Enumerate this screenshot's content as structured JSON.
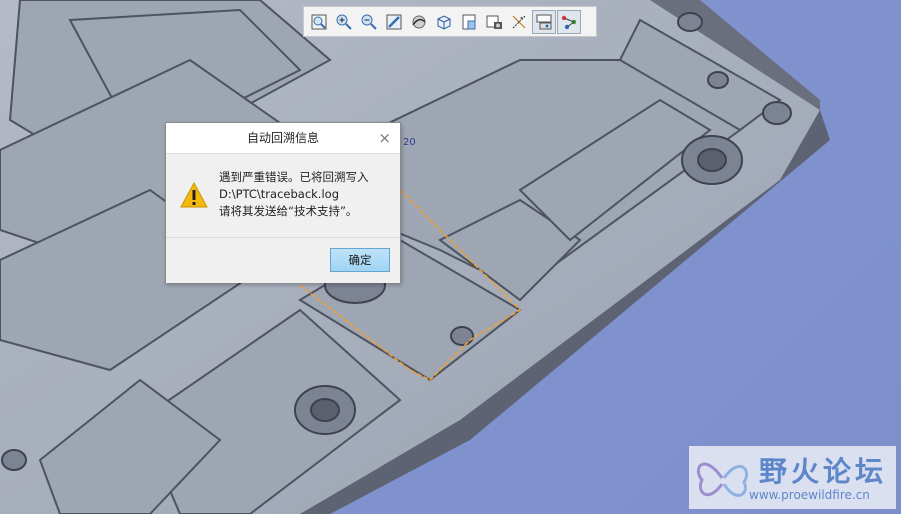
{
  "toolbar": {
    "buttons": [
      {
        "icon": "zoom-fit-icon"
      },
      {
        "icon": "zoom-in-icon"
      },
      {
        "icon": "zoom-out-icon"
      },
      {
        "icon": "repaint-icon"
      },
      {
        "icon": "reorient-icon"
      },
      {
        "icon": "display-style-icon"
      },
      {
        "icon": "saved-views-icon"
      },
      {
        "icon": "view-manager-icon"
      },
      {
        "icon": "datum-display-icon"
      },
      {
        "icon": "spin-center-icon",
        "active": true
      },
      {
        "icon": "annotation-display-icon",
        "active": true
      }
    ]
  },
  "dialog": {
    "title": "自动回溯信息",
    "close": "×",
    "icon": "warning-icon",
    "message_line1": "遇到严重错误。已将回溯写入",
    "message_line2": "D:\\PTC\\traceback.log",
    "message_line3": "请将其发送给“技术支持”。",
    "ok_label": "确定"
  },
  "viewport": {
    "label": "20"
  },
  "watermark": {
    "title": "野火论坛",
    "url": "www.proewildfire.cn"
  },
  "colors": {
    "background": "#8294cf",
    "part": "#a8b0bf",
    "accent": "#f0a030"
  }
}
